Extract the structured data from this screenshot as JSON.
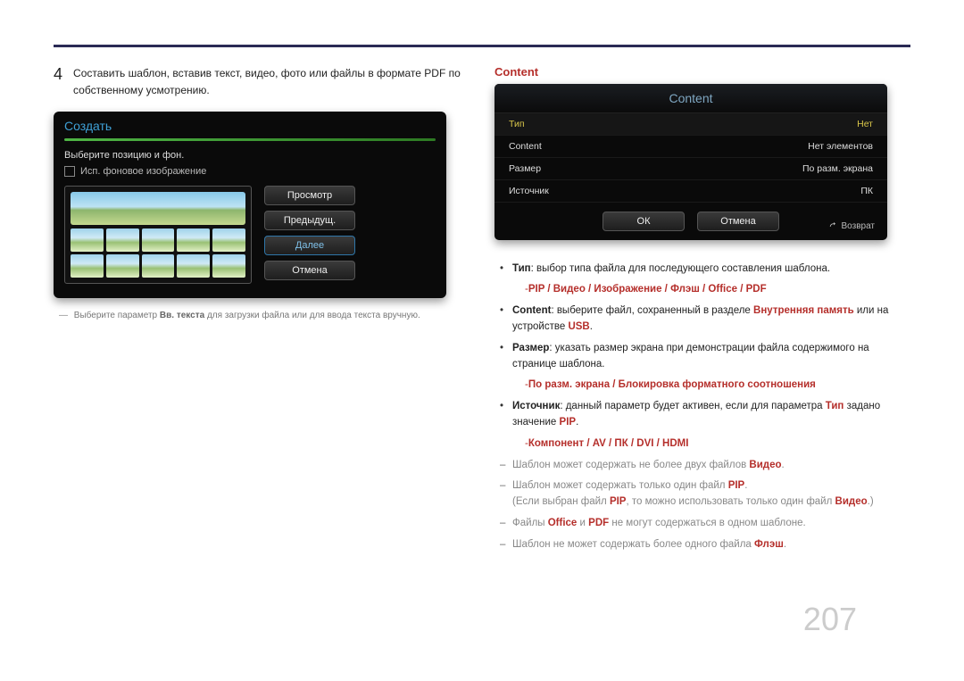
{
  "page_number": "207",
  "step": {
    "num": "4",
    "text": "Составить шаблон, вставив текст, видео, фото или файлы в формате PDF по собственному усмотрению."
  },
  "ui_create": {
    "title": "Создать",
    "subtitle": "Выберите позицию и фон.",
    "checkbox": "Исп. фоновое изображение",
    "btn_view": "Просмотр",
    "btn_prev": "Предыдущ.",
    "btn_next": "Далее",
    "btn_cancel": "Отмена"
  },
  "footnote": {
    "pre": "Выберите параметр ",
    "bold": "Вв. текста",
    "post": " для загрузки файла или для ввода текста вручную."
  },
  "right": {
    "heading": "Content",
    "ui_title": "Content",
    "rows": {
      "r1l": "Тип",
      "r1r": "Нет",
      "r2l": "Content",
      "r2r": "Нет элементов",
      "r3l": "Размер",
      "r3r": "По разм. экрана",
      "r4l": "Источник",
      "r4r": "ПК"
    },
    "ok": "ОК",
    "cancel": "Отмена",
    "return": "Возврат"
  },
  "bl": {
    "b1_strong": "Тип",
    "b1_rest": ": выбор типа файла для последующего составления шаблона.",
    "b1_sub": "PIP / Видео / Изображение / Флэш / Office / PDF",
    "b2_strong": "Content",
    "b2_mid": ": выберите файл, сохраненный в разделе ",
    "b2_mem": "Внутренняя память",
    "b2_or": " или на устройстве ",
    "b2_usb": "USB",
    "b2_dot": ".",
    "b3_strong": "Размер",
    "b3_rest": ": указать размер экрана при демонстрации файла содержимого на странице шаблона.",
    "b3_sub": "По разм. экрана / Блокировка форматного соотношения",
    "b4_strong": "Источник",
    "b4_mid": ": данный параметр будет активен, если для параметра ",
    "b4_type": "Тип",
    "b4_set": " задано значение ",
    "b4_pip": "PIP",
    "b4_dot": ".",
    "b4_sub": "Компонент / AV / ПК / DVI / HDMI",
    "n1_a": "Шаблон может содержать не более двух файлов ",
    "n1_b": "Видео",
    "n1_c": ".",
    "n2_a": "Шаблон может содержать только один файл ",
    "n2_b": "PIP",
    "n2_c": ".",
    "n2p_a": "(Если выбран файл ",
    "n2p_b": "PIP",
    "n2p_c": ", то можно использовать только один файл ",
    "n2p_d": "Видео",
    "n2p_e": ".)",
    "n3_a": "Файлы ",
    "n3_b": "Office",
    "n3_c": " и ",
    "n3_d": "PDF",
    "n3_e": " не могут содержаться в одном шаблоне.",
    "n4_a": "Шаблон не может содержать более одного файла ",
    "n4_b": "Флэш",
    "n4_c": "."
  }
}
